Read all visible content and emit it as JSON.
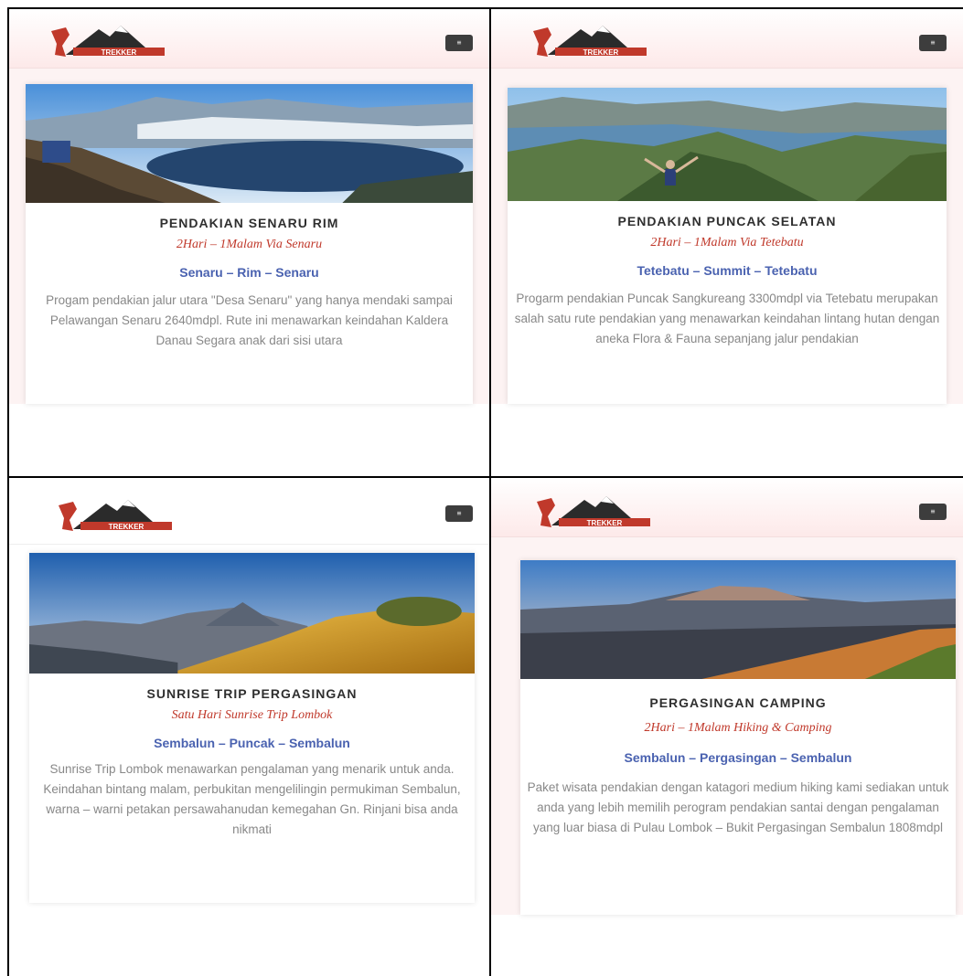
{
  "brand": {
    "accent": "#c0392b",
    "route_color": "#4a62b0",
    "menu_label": "≡"
  },
  "panels": [
    {
      "title": "PENDAKIAN SENARU RIM",
      "subtitle": "2Hari – 1Malam Via Senaru",
      "route": "Senaru – Rim – Senaru",
      "description": "Progam pendakian jalur utara \"Desa Senaru\" yang hanya mendaki sampai Pelawangan Senaru 2640mdpl. Rute ini menawarkan keindahan Kaldera Danau Segara anak dari sisi utara"
    },
    {
      "title": "PENDAKIAN PUNCAK SELATAN",
      "subtitle": "2Hari – 1Malam Via Tetebatu",
      "route": "Tetebatu – Summit – Tetebatu",
      "description": "Progarm pendakian Puncak Sangkureang 3300mdpl via Tetebatu merupakan salah satu rute pendakian yang menawarkan keindahan lintang hutan dengan aneka Flora & Fauna sepanjang jalur pendakian"
    },
    {
      "title": "SUNRISE TRIP PERGASINGAN",
      "subtitle": "Satu Hari Sunrise Trip Lombok",
      "route": "Sembalun – Puncak – Sembalun",
      "description": "Sunrise Trip Lombok menawarkan pengalaman yang menarik untuk anda. Keindahan bintang malam, perbukitan mengelilingin permukiman Sembalun, warna – warni petakan persawahanudan kemegahan Gn. Rinjani bisa anda nikmati"
    },
    {
      "title": "PERGASINGAN CAMPING",
      "subtitle": "2Hari – 1Malam Hiking & Camping",
      "route": "Sembalun – Pergasingan – Sembalun",
      "description": "Paket wisata pendakian dengan katagori medium hiking kami sediakan untuk anda yang lebih memilih perogram pendakian santai dengan pengalaman yang luar biasa di Pulau Lombok – Bukit Pergasingan Sembalun 1808mdpl"
    }
  ]
}
